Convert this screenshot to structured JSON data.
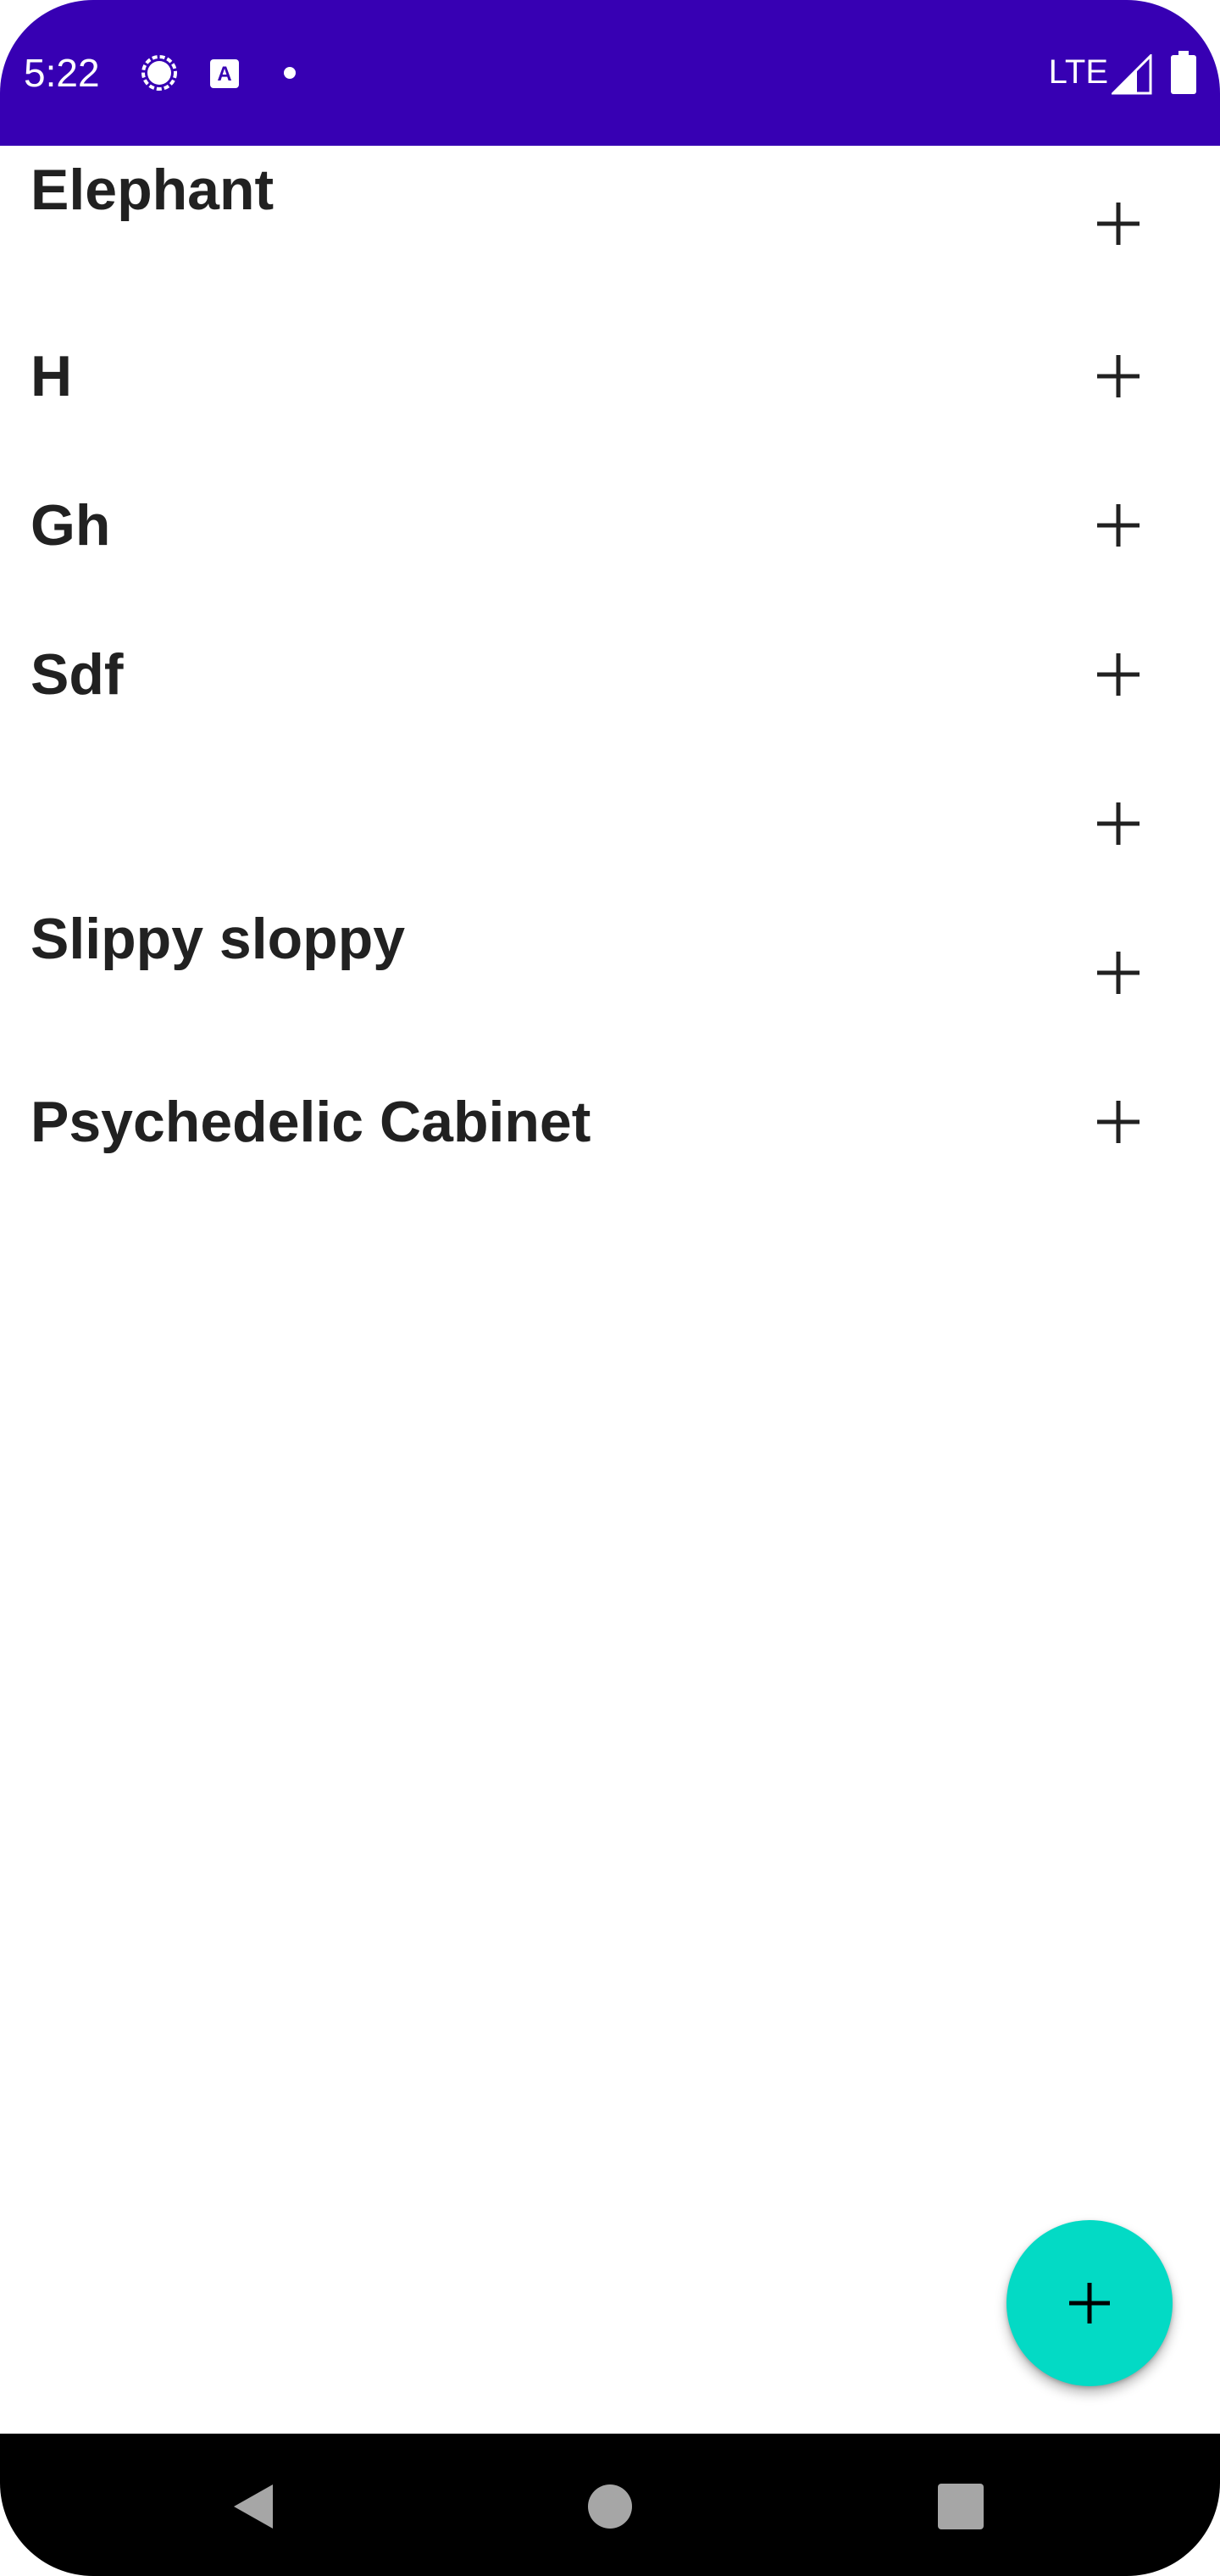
{
  "status_bar": {
    "time": "5:22",
    "network": "LTE",
    "icons": [
      "signal-messenger-icon",
      "app-notification-icon",
      "notification-dot-icon",
      "cell-signal-icon",
      "battery-icon"
    ],
    "background_color": "#3700b3"
  },
  "list": {
    "items": [
      {
        "title": "Elephant",
        "action_icon": "plus-icon"
      },
      {
        "title": "H",
        "action_icon": "plus-icon"
      },
      {
        "title": "Gh",
        "action_icon": "plus-icon"
      },
      {
        "title": "Sdf",
        "action_icon": "plus-icon"
      },
      {
        "title": "",
        "action_icon": "plus-icon"
      },
      {
        "title": "Slippy sloppy",
        "action_icon": "plus-icon"
      },
      {
        "title": "Psychedelic Cabinet",
        "action_icon": "plus-icon"
      }
    ]
  },
  "fab": {
    "icon": "plus-icon",
    "color": "#03dac5"
  },
  "nav_bar": {
    "buttons": [
      "back-icon",
      "home-icon",
      "recents-icon"
    ]
  }
}
